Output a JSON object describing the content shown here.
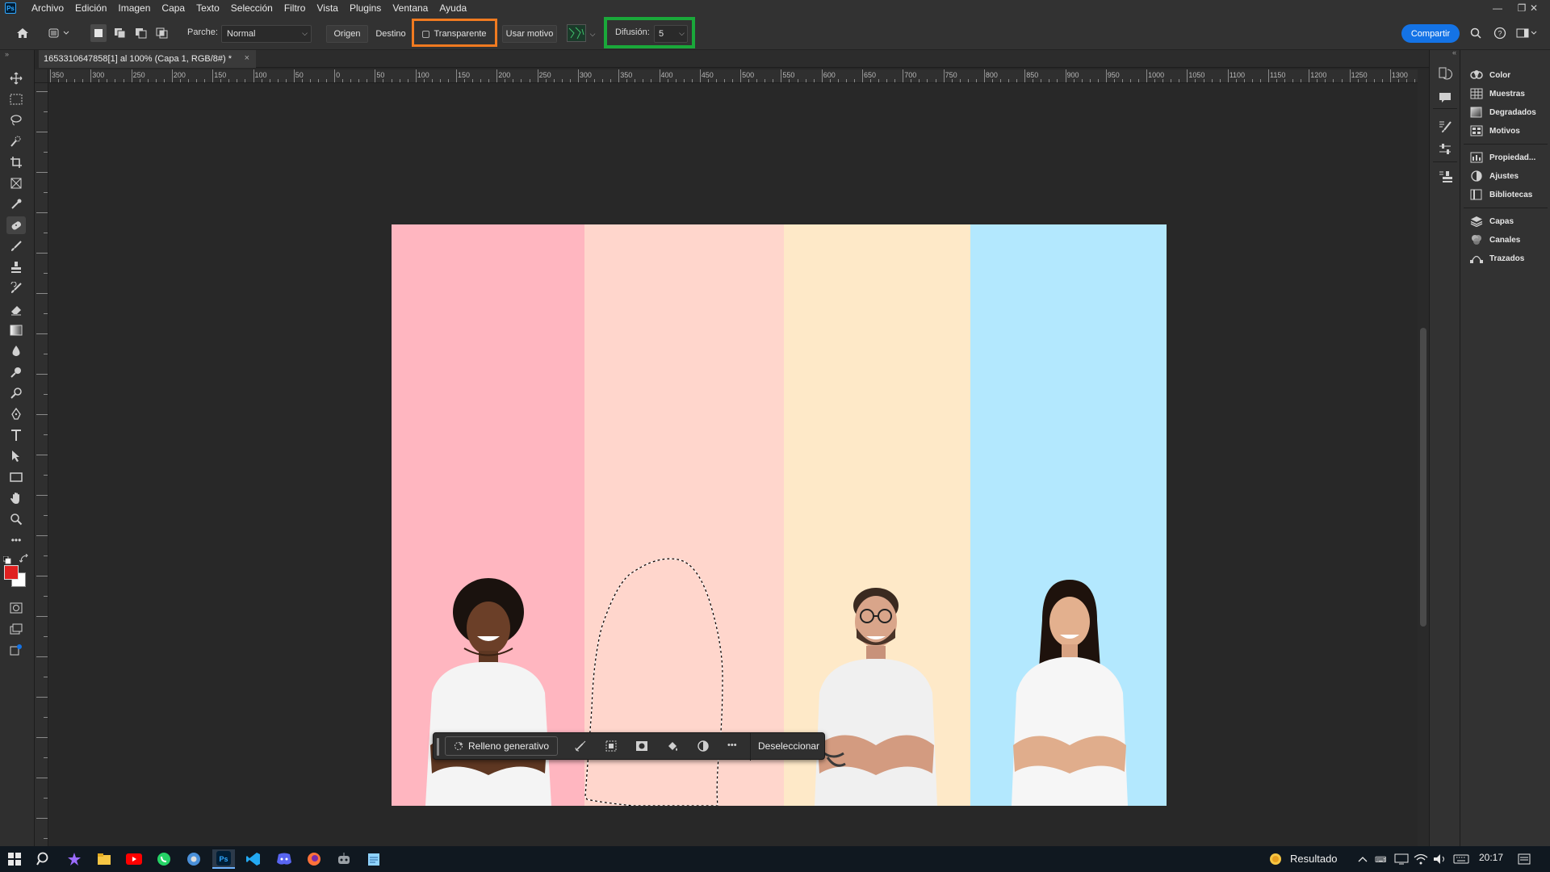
{
  "app": {
    "logo": "Ps",
    "menu": [
      "Archivo",
      "Edición",
      "Imagen",
      "Capa",
      "Texto",
      "Selección",
      "Filtro",
      "Vista",
      "Plugins",
      "Ventana",
      "Ayuda"
    ]
  },
  "options_bar": {
    "patch_label": "Parche:",
    "patch_value": "Normal",
    "source_label": "Origen",
    "dest_label": "Destino",
    "transparent_label": "Transparente",
    "transparent_checked": false,
    "use_pattern_label": "Usar motivo",
    "diffusion_label": "Difusión:",
    "diffusion_value": "5",
    "share_label": "Compartir",
    "highlight_orange": "#f07a20",
    "highlight_green": "#1aa83a"
  },
  "document": {
    "tab_title": "1653310647858[1] al 100% (Capa 1, RGB/8#) *",
    "close": "×"
  },
  "ruler": {
    "h_labels": [
      "350",
      "300",
      "250",
      "200",
      "150",
      "100",
      "50",
      "0",
      "50",
      "100",
      "150",
      "200",
      "250",
      "300",
      "350",
      "400",
      "450",
      "500",
      "550",
      "600",
      "650",
      "700",
      "750",
      "800",
      "850",
      "900",
      "950",
      "1000",
      "1050",
      "1100",
      "1150",
      "1200",
      "1250",
      "1300"
    ]
  },
  "canvas": {
    "stripe_colors": [
      "#ffb6c0",
      "#ffd6cc",
      "#fee9c8",
      "#b3e8fe"
    ],
    "people": [
      "person-afro-hair",
      "person-glasses-beard",
      "person-long-hair"
    ]
  },
  "context_bar": {
    "generative_fill": "Relleno generativo",
    "deselect": "Deseleccionar",
    "more": "•••"
  },
  "right_panels": {
    "group1": [
      "Color",
      "Muestras",
      "Degradados",
      "Motivos"
    ],
    "group2": [
      "Propiedad...",
      "Ajustes",
      "Bibliotecas"
    ],
    "group3": [
      "Capas",
      "Canales",
      "Trazados"
    ]
  },
  "taskbar": {
    "weather_label": "Resultado",
    "time": "20:17"
  },
  "colors": {
    "foreground": "#e02020",
    "background": "#ffffff",
    "accent_blue": "#1473e6"
  }
}
